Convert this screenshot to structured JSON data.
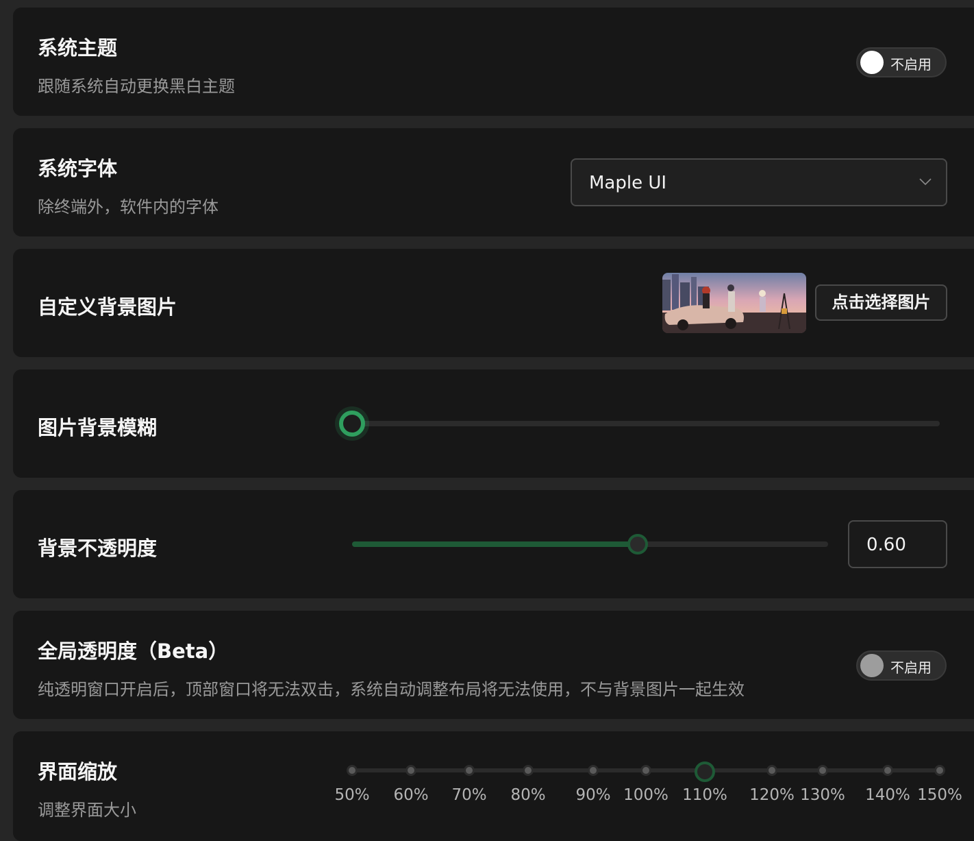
{
  "theme": {
    "title": "系统主题",
    "desc": "跟随系统自动更换黑白主题",
    "toggle_label": "不启用",
    "enabled": false
  },
  "font": {
    "title": "系统字体",
    "desc": "除终端外，软件内的字体",
    "value": "Maple UI"
  },
  "bg_image": {
    "title": "自定义背景图片",
    "button": "点击选择图片"
  },
  "blur": {
    "title": "图片背景模糊",
    "value": 0
  },
  "opacity": {
    "title": "背景不透明度",
    "value": "0.60",
    "level": 0.6
  },
  "global_transparency": {
    "title": "全局透明度（Beta）",
    "desc": "纯透明窗口开启后，顶部窗口将无法双击，系统自动调整布局将无法使用，不与背景图片一起生效",
    "toggle_label": "不启用",
    "enabled": false
  },
  "scale": {
    "title": "界面缩放",
    "desc": "调整界面大小",
    "marks": [
      "50%",
      "60%",
      "70%",
      "80%",
      "90%",
      "100%",
      "110%",
      "120%",
      "130%",
      "140%",
      "150%"
    ],
    "selected": "110%"
  },
  "colors": {
    "accent": "#2f9e5e",
    "accent_dark": "#1e5a36",
    "card": "#171717",
    "page": "#262626"
  }
}
